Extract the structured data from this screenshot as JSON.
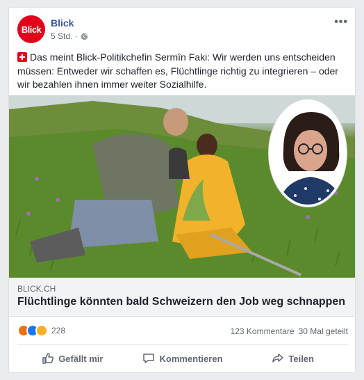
{
  "post": {
    "page_name": "Blick",
    "avatar_text": "Blick",
    "time": "5 Std. ·",
    "text": "Das meint Blick-Politikchefin Sermîn Faki: Wir werden uns entscheiden müssen: Entweder wir schaffen es, Flüchtlinge richtig zu integrieren – oder wir bezahlen ihnen immer weiter Sozialhilfe.",
    "colors": {
      "brand_red": "#e2001a",
      "link_blue": "#385898"
    }
  },
  "link": {
    "domain": "BLICK.CH",
    "headline": "Flüchtlinge könnten bald Schweizern den Job weg schnappen"
  },
  "stats": {
    "reaction_count": "228",
    "comments": "123 Kommentare",
    "shares": "30 Mal geteilt"
  },
  "actions": {
    "like": "Gefällt mir",
    "comment": "Kommentieren",
    "share": "Teilen"
  }
}
